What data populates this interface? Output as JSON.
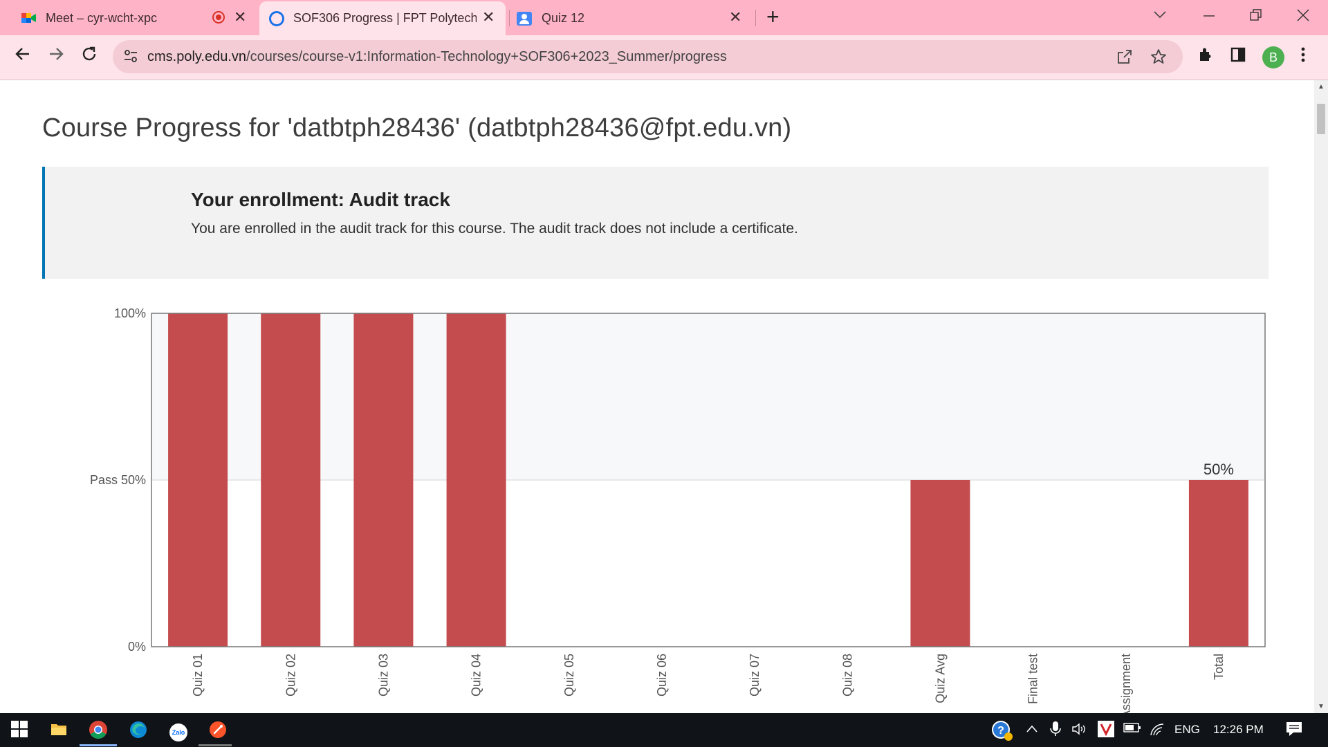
{
  "browser": {
    "tabs": [
      {
        "title": "Meet – cyr-wcht-xpc",
        "icon": "google-meet-icon",
        "recording": true
      },
      {
        "title": "SOF306 Progress | FPT Polytechn",
        "icon": "loading-ring-icon",
        "active": true
      },
      {
        "title": "Quiz 12",
        "icon": "google-classroom-icon"
      }
    ],
    "new_tab": "+",
    "url_host": "cms.poly.edu.vn",
    "url_path": "/courses/course-v1:Information-Technology+SOF306+2023_Summer/progress",
    "profile_initial": "B"
  },
  "page": {
    "title": "Course Progress for 'datbtph28436' (datbtph28436@fpt.edu.vn)",
    "enrollment_title": "Your enrollment: Audit track",
    "enrollment_text": "You are enrolled in the audit track for this course. The audit track does not include a certificate."
  },
  "chart_data": {
    "type": "bar",
    "categories": [
      "Quiz 01",
      "Quiz 02",
      "Quiz 03",
      "Quiz 04",
      "Quiz 05",
      "Quiz 06",
      "Quiz 07",
      "Quiz 08",
      "Quiz Avg",
      "Final test",
      "Assignment",
      "Total"
    ],
    "values": [
      100,
      100,
      100,
      100,
      0,
      0,
      0,
      0,
      50,
      0,
      0,
      50
    ],
    "y_ticks": [
      {
        "value": 100,
        "label": "100%"
      },
      {
        "value": 50,
        "label": "Pass 50%"
      },
      {
        "value": 0,
        "label": "0%"
      }
    ],
    "pass_threshold": 50,
    "total_label": "50%",
    "ylim": [
      0,
      100
    ],
    "bar_color": "#c44c4f",
    "pass_zone_color": "#f7f8fa"
  },
  "taskbar": {
    "apps": [
      "windows-start-icon",
      "file-explorer-icon",
      "chrome-icon",
      "edge-icon",
      "zalo-icon",
      "brave-icon"
    ],
    "zalo_label": "Zalo",
    "language": "ENG",
    "time": "12:26 PM"
  },
  "colors": {
    "tab_strip": "#ffb3c6",
    "toolbar": "#ffe3ea",
    "omnibox": "#f4ccd6",
    "enroll_border": "#0075b4"
  }
}
